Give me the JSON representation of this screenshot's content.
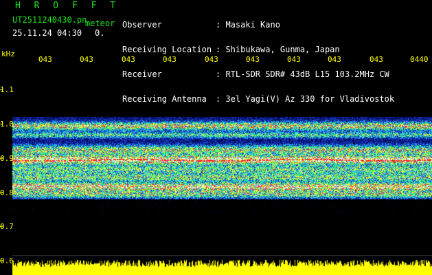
{
  "header": {
    "program": "H R O F F T",
    "filename": "UT2511240430.pn",
    "mode": "meteor",
    "datetime": "25.11.24 04:30",
    "speed": "0.",
    "info": [
      {
        "label": "Observer",
        "value": ": Masaki Kano"
      },
      {
        "label": "Receiving Location",
        "value": ": Shibukawa, Gunma, Japan"
      },
      {
        "label": "Receiver",
        "value": ": RTL-SDR SDR# 43dB L15 103.2MHz CW"
      },
      {
        "label": "Receiving Antenna",
        "value": ": 3el Yagi(V) Az 330 for Vladivostok"
      }
    ]
  },
  "time_axis": {
    "labels": [
      "043",
      "043",
      "043",
      "043",
      "043",
      "043",
      "043",
      "043",
      "043",
      "0440"
    ]
  },
  "freq_axis": {
    "unit": "kHz",
    "labels": [
      "1.1",
      "1.0",
      "0.9",
      "0.8",
      "0.7",
      "0.6"
    ]
  },
  "colors": {
    "text_green": "#19e619",
    "text_white": "#ffffff",
    "axis_yellow": "#ffff00",
    "waterfall_bg": "#00003a",
    "trace_red": "#ff2020",
    "baseline_yellow": "#ffff00"
  }
}
